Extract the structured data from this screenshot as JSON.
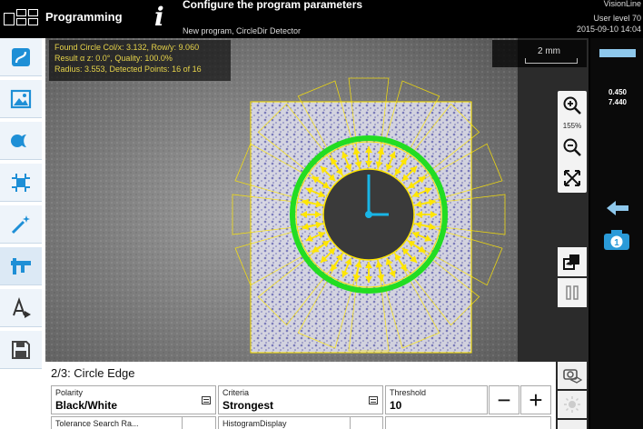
{
  "header": {
    "app_title": "Programming",
    "title": "Configure the program parameters",
    "subtitle": "New program, CircleDir Detector",
    "brand": "VisionLine",
    "user_level": "User level 70",
    "datetime": "2015-09-10 14:04"
  },
  "toolbar": {
    "items": [
      {
        "name": "program-step-tool",
        "icon": "s-curve-icon"
      },
      {
        "name": "image-tool",
        "icon": "image-icon"
      },
      {
        "name": "shape-tool",
        "icon": "circle-shapes-icon"
      },
      {
        "name": "crop-tool",
        "icon": "crop-icon"
      },
      {
        "name": "wand-tool",
        "icon": "magic-wand-icon"
      },
      {
        "name": "caliper-tool",
        "icon": "caliper-icon"
      },
      {
        "name": "output-tool",
        "icon": "document-play-icon"
      },
      {
        "name": "save-tool",
        "icon": "save-icon"
      }
    ]
  },
  "result": {
    "line1": "Found Circle Col/x: 3.132, Row/y: 9.060",
    "line2": "Result α z: 0.0°, Quality: 100.0%",
    "line3": "Radius: 3.553, Detected Points: 16 of 16"
  },
  "scale": {
    "label": "2 mm"
  },
  "zoom": {
    "percent": "155%"
  },
  "right_panel": {
    "value1": "0.450",
    "value2": "7.440",
    "accent": "#8ec8ec"
  },
  "params": {
    "title": "2/3: Circle Edge",
    "polarity": {
      "label": "Polarity",
      "value": "Black/White"
    },
    "criteria": {
      "label": "Criteria",
      "value": "Strongest"
    },
    "threshold": {
      "label": "Threshold",
      "value": "10"
    },
    "tolerance": {
      "label": "Tolerance Search Ra..."
    },
    "histogram": {
      "label": "HistogramDisplay"
    },
    "minus": "−",
    "plus": "+"
  },
  "colors": {
    "overlay": "#ffe600",
    "circle": "#22dd22",
    "hand": "#19b5e6",
    "toolbar_icon": "#1e8fd6"
  }
}
